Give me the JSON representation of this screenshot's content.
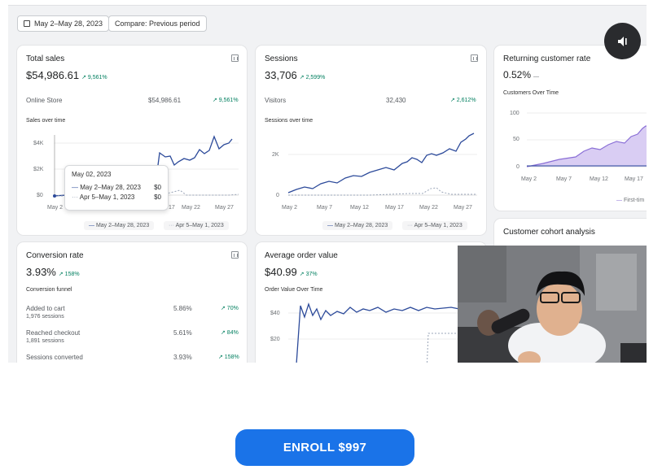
{
  "toolbar": {
    "date_range": "May 2–May 28, 2023",
    "compare": "Compare: Previous period"
  },
  "total_sales": {
    "title": "Total sales",
    "value": "$54,986.61",
    "change": "↗ 9,561%",
    "row_label": "Online Store",
    "row_value": "$54,986.61",
    "row_change": "↗ 9,561%",
    "subtitle": "Sales over time",
    "y_ticks": [
      "$4K",
      "$2K",
      "$0"
    ],
    "x_ticks": [
      "May 2",
      "17",
      "May 22",
      "May 27"
    ],
    "legend_current": "May 2–May 28, 2023",
    "legend_previous": "Apr 5–May 1, 2023",
    "tooltip": {
      "date": "May 02, 2023",
      "current_label": "May 2–May 28, 2023",
      "current_value": "$0",
      "previous_label": "Apr 5–May 1, 2023",
      "previous_value": "$0"
    }
  },
  "sessions": {
    "title": "Sessions",
    "value": "33,706",
    "change": "↗ 2,599%",
    "row_label": "Visitors",
    "row_value": "32,430",
    "row_change": "↗ 2,612%",
    "subtitle": "Sessions over time",
    "y_ticks": [
      "2K",
      "0"
    ],
    "x_ticks": [
      "May 2",
      "May 7",
      "May 12",
      "May 17",
      "May 22",
      "May 27"
    ],
    "legend_current": "May 2–May 28, 2023",
    "legend_previous": "Apr 5–May 1, 2023"
  },
  "returning": {
    "title": "Returning customer rate",
    "value": "0.52%",
    "change": "—",
    "subtitle": "Customers Over Time",
    "y_ticks": [
      "100",
      "50",
      "0"
    ],
    "x_ticks": [
      "May 2",
      "May 7",
      "May 12",
      "May 17"
    ],
    "legend": "First-tim"
  },
  "cohort": {
    "title": "Customer cohort analysis"
  },
  "conversion": {
    "title": "Conversion rate",
    "value": "3.93%",
    "change": "↗ 158%",
    "subtitle": "Conversion funnel",
    "rows": [
      {
        "label": "Added to cart",
        "sub": "1,976 sessions",
        "pct": "5.86%",
        "chg": "↗ 70%"
      },
      {
        "label": "Reached checkout",
        "sub": "1,891 sessions",
        "pct": "5.61%",
        "chg": "↗ 84%"
      },
      {
        "label": "Sessions converted",
        "sub": "",
        "pct": "3.93%",
        "chg": "↗ 158%"
      }
    ]
  },
  "aov": {
    "title": "Average order value",
    "value": "$40.99",
    "change": "↗ 37%",
    "subtitle": "Order Value Over Time",
    "y_ticks": [
      "$40",
      "$20"
    ]
  },
  "cta": {
    "enroll_label": "ENROLL $997"
  },
  "colors": {
    "accent": "#1a73e8",
    "series": "#2c4a9a",
    "purple": "#8a6fd6",
    "positive": "#007f5f"
  }
}
